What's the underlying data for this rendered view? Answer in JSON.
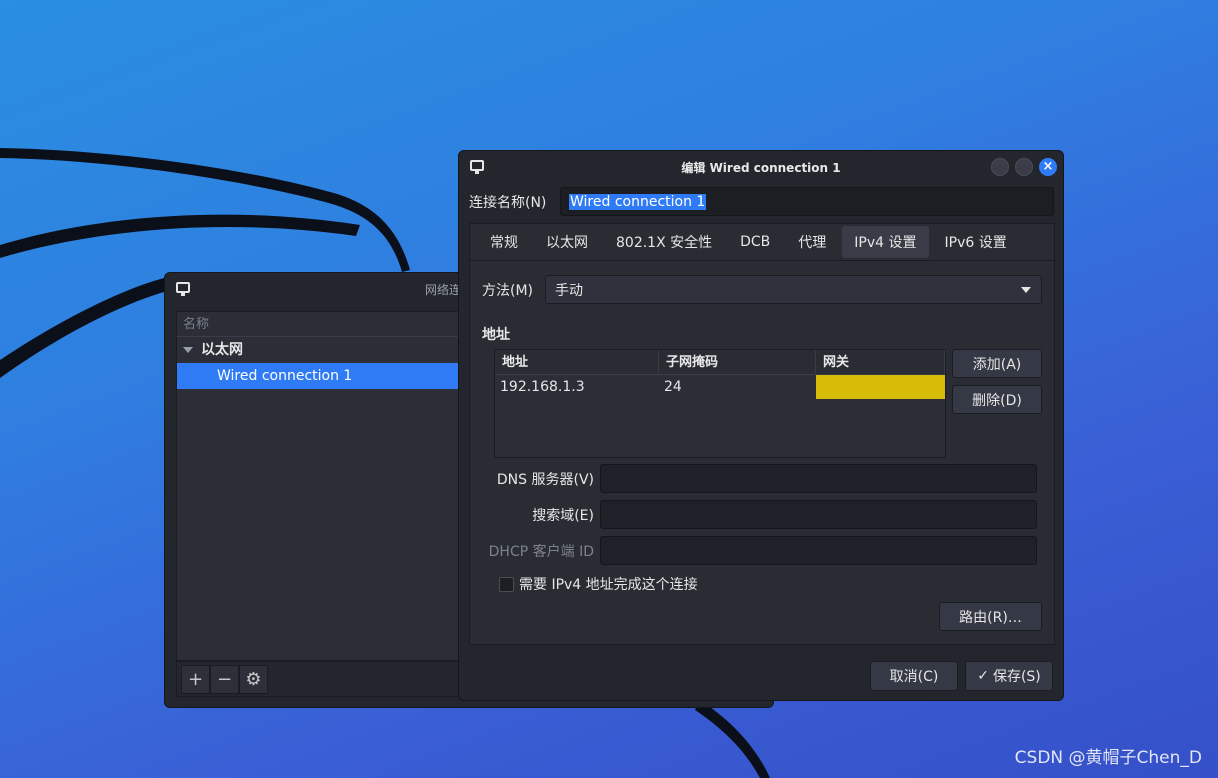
{
  "desktop": {
    "watermark": "CSDN @黄帽子Chen_D"
  },
  "connections_window": {
    "title": "网络连",
    "list_header": "名称",
    "group_label": "以太网",
    "selected_item": "Wired connection 1",
    "toolbar": {
      "add_icon": "plus-icon",
      "remove_icon": "minus-icon",
      "settings_icon": "gear-icon"
    }
  },
  "edit_dialog": {
    "title": "编辑 Wired connection 1",
    "connection_name_label": "连接名称(N)",
    "connection_name_value": "Wired connection 1",
    "tabs": [
      {
        "label": "常规"
      },
      {
        "label": "以太网"
      },
      {
        "label": "802.1X 安全性"
      },
      {
        "label": "DCB"
      },
      {
        "label": "代理"
      },
      {
        "label": "IPv4 设置",
        "active": true
      },
      {
        "label": "IPv6 设置"
      }
    ],
    "ipv4": {
      "method_label": "方法(M)",
      "method_value": "手动",
      "addresses_section": "地址",
      "table_headers": [
        "地址",
        "子网掩码",
        "网关"
      ],
      "rows": [
        {
          "address": "192.168.1.3",
          "netmask": "24",
          "gateway": ""
        }
      ],
      "add_button": "添加(A)",
      "delete_button": "删除(D)",
      "dns_label": "DNS 服务器(V)",
      "dns_value": "",
      "search_label": "搜索域(E)",
      "search_value": "",
      "dhcp_label": "DHCP 客户端 ID",
      "dhcp_value": "",
      "require_ipv4_label": "需要 IPv4 地址完成这个连接",
      "require_ipv4_checked": false,
      "routes_button": "路由(R)…"
    },
    "cancel_button": "取消(C)",
    "save_button": "保存(S)",
    "highlight_color": "#2f7bf5",
    "gateway_edit_color": "#d6bc06"
  }
}
